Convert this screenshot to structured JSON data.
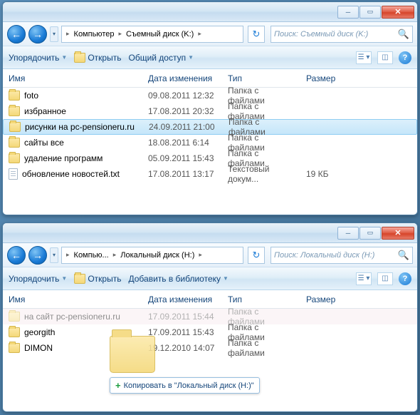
{
  "win1": {
    "crumbs": [
      "Компьютер",
      "Съемный диск (K:)"
    ],
    "search_placeholder": "Поиск: Съемный диск (K:)",
    "toolbar": {
      "organize": "Упорядочить",
      "open": "Открыть",
      "share": "Общий доступ"
    },
    "cols": {
      "name": "Имя",
      "date": "Дата изменения",
      "type": "Тип",
      "size": "Размер"
    },
    "rows": [
      {
        "icon": "folder",
        "name": "foto",
        "date": "09.08.2011 12:32",
        "type": "Папка с файлами",
        "size": ""
      },
      {
        "icon": "folder",
        "name": "избранное",
        "date": "17.08.2011 20:32",
        "type": "Папка с файлами",
        "size": ""
      },
      {
        "icon": "folder",
        "name": "рисунки на pc-pensioneru.ru",
        "date": "24.09.2011 21:00",
        "type": "Папка с файлами",
        "size": "",
        "selected": true
      },
      {
        "icon": "folder",
        "name": "сайты все",
        "date": "18.08.2011 6:14",
        "type": "Папка с файлами",
        "size": ""
      },
      {
        "icon": "folder",
        "name": "удаление программ",
        "date": "05.09.2011 15:43",
        "type": "Папка с файлами",
        "size": ""
      },
      {
        "icon": "txt",
        "name": "обновление новостей.txt",
        "date": "17.08.2011 13:17",
        "type": "Текстовый докум...",
        "size": "19 КБ"
      }
    ]
  },
  "win2": {
    "crumbs": [
      "Компью...",
      "Локальный диск (H:)"
    ],
    "search_placeholder": "Поиск: Локальный диск (H:)",
    "toolbar": {
      "organize": "Упорядочить",
      "open": "Открыть",
      "library": "Добавить в библиотеку"
    },
    "cols": {
      "name": "Имя",
      "date": "Дата изменения",
      "type": "Тип",
      "size": "Размер"
    },
    "rows": [
      {
        "icon": "folder",
        "name": "на сайт pc-pensioneru.ru",
        "date": "17.09.2011 15:44",
        "type": "Папка с файлами",
        "size": "",
        "fade": true
      },
      {
        "icon": "folder",
        "name": "georgith",
        "date": "17.09.2011 15:43",
        "type": "Папка с файлами",
        "size": ""
      },
      {
        "icon": "folder",
        "name": "DIMON",
        "date": "19.12.2010 14:07",
        "type": "Папка с файлами",
        "size": ""
      }
    ],
    "drop_hint": "Копировать в \"Локальный диск (H:)\""
  }
}
